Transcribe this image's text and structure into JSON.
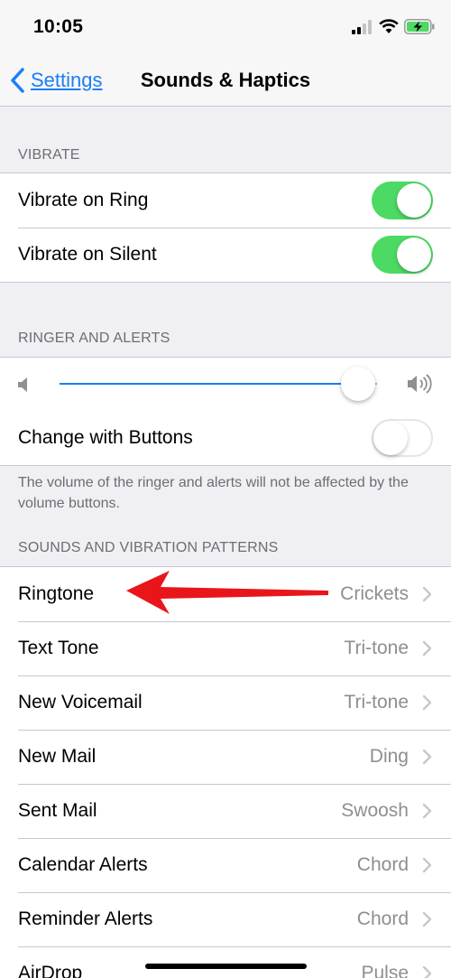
{
  "status_bar": {
    "time": "10:05"
  },
  "nav": {
    "back_label": "Settings",
    "title": "Sounds & Haptics"
  },
  "vibrate": {
    "header": "VIBRATE",
    "rows": [
      {
        "label": "Vibrate on Ring",
        "on": true
      },
      {
        "label": "Vibrate on Silent",
        "on": true
      }
    ]
  },
  "ringer": {
    "header": "RINGER AND ALERTS",
    "volume_level": 0.94,
    "change_with_buttons_label": "Change with Buttons",
    "change_with_buttons_on": false,
    "footer": "The volume of the ringer and alerts will not be affected by the volume buttons."
  },
  "sounds": {
    "header": "SOUNDS AND VIBRATION PATTERNS",
    "rows": [
      {
        "label": "Ringtone",
        "value": "Crickets"
      },
      {
        "label": "Text Tone",
        "value": "Tri-tone"
      },
      {
        "label": "New Voicemail",
        "value": "Tri-tone"
      },
      {
        "label": "New Mail",
        "value": "Ding"
      },
      {
        "label": "Sent Mail",
        "value": "Swoosh"
      },
      {
        "label": "Calendar Alerts",
        "value": "Chord"
      },
      {
        "label": "Reminder Alerts",
        "value": "Chord"
      },
      {
        "label": "AirDrop",
        "value": "Pulse"
      }
    ]
  },
  "colors": {
    "accent": "#1a7ef7",
    "toggle_on": "#4cd964",
    "arrow": "#e8161b"
  },
  "icons": [
    "back-chevron-icon",
    "cellular-signal-icon",
    "wifi-icon",
    "battery-charging-icon",
    "volume-low-icon",
    "volume-high-icon",
    "chevron-right-icon",
    "red-arrow-annotation"
  ]
}
